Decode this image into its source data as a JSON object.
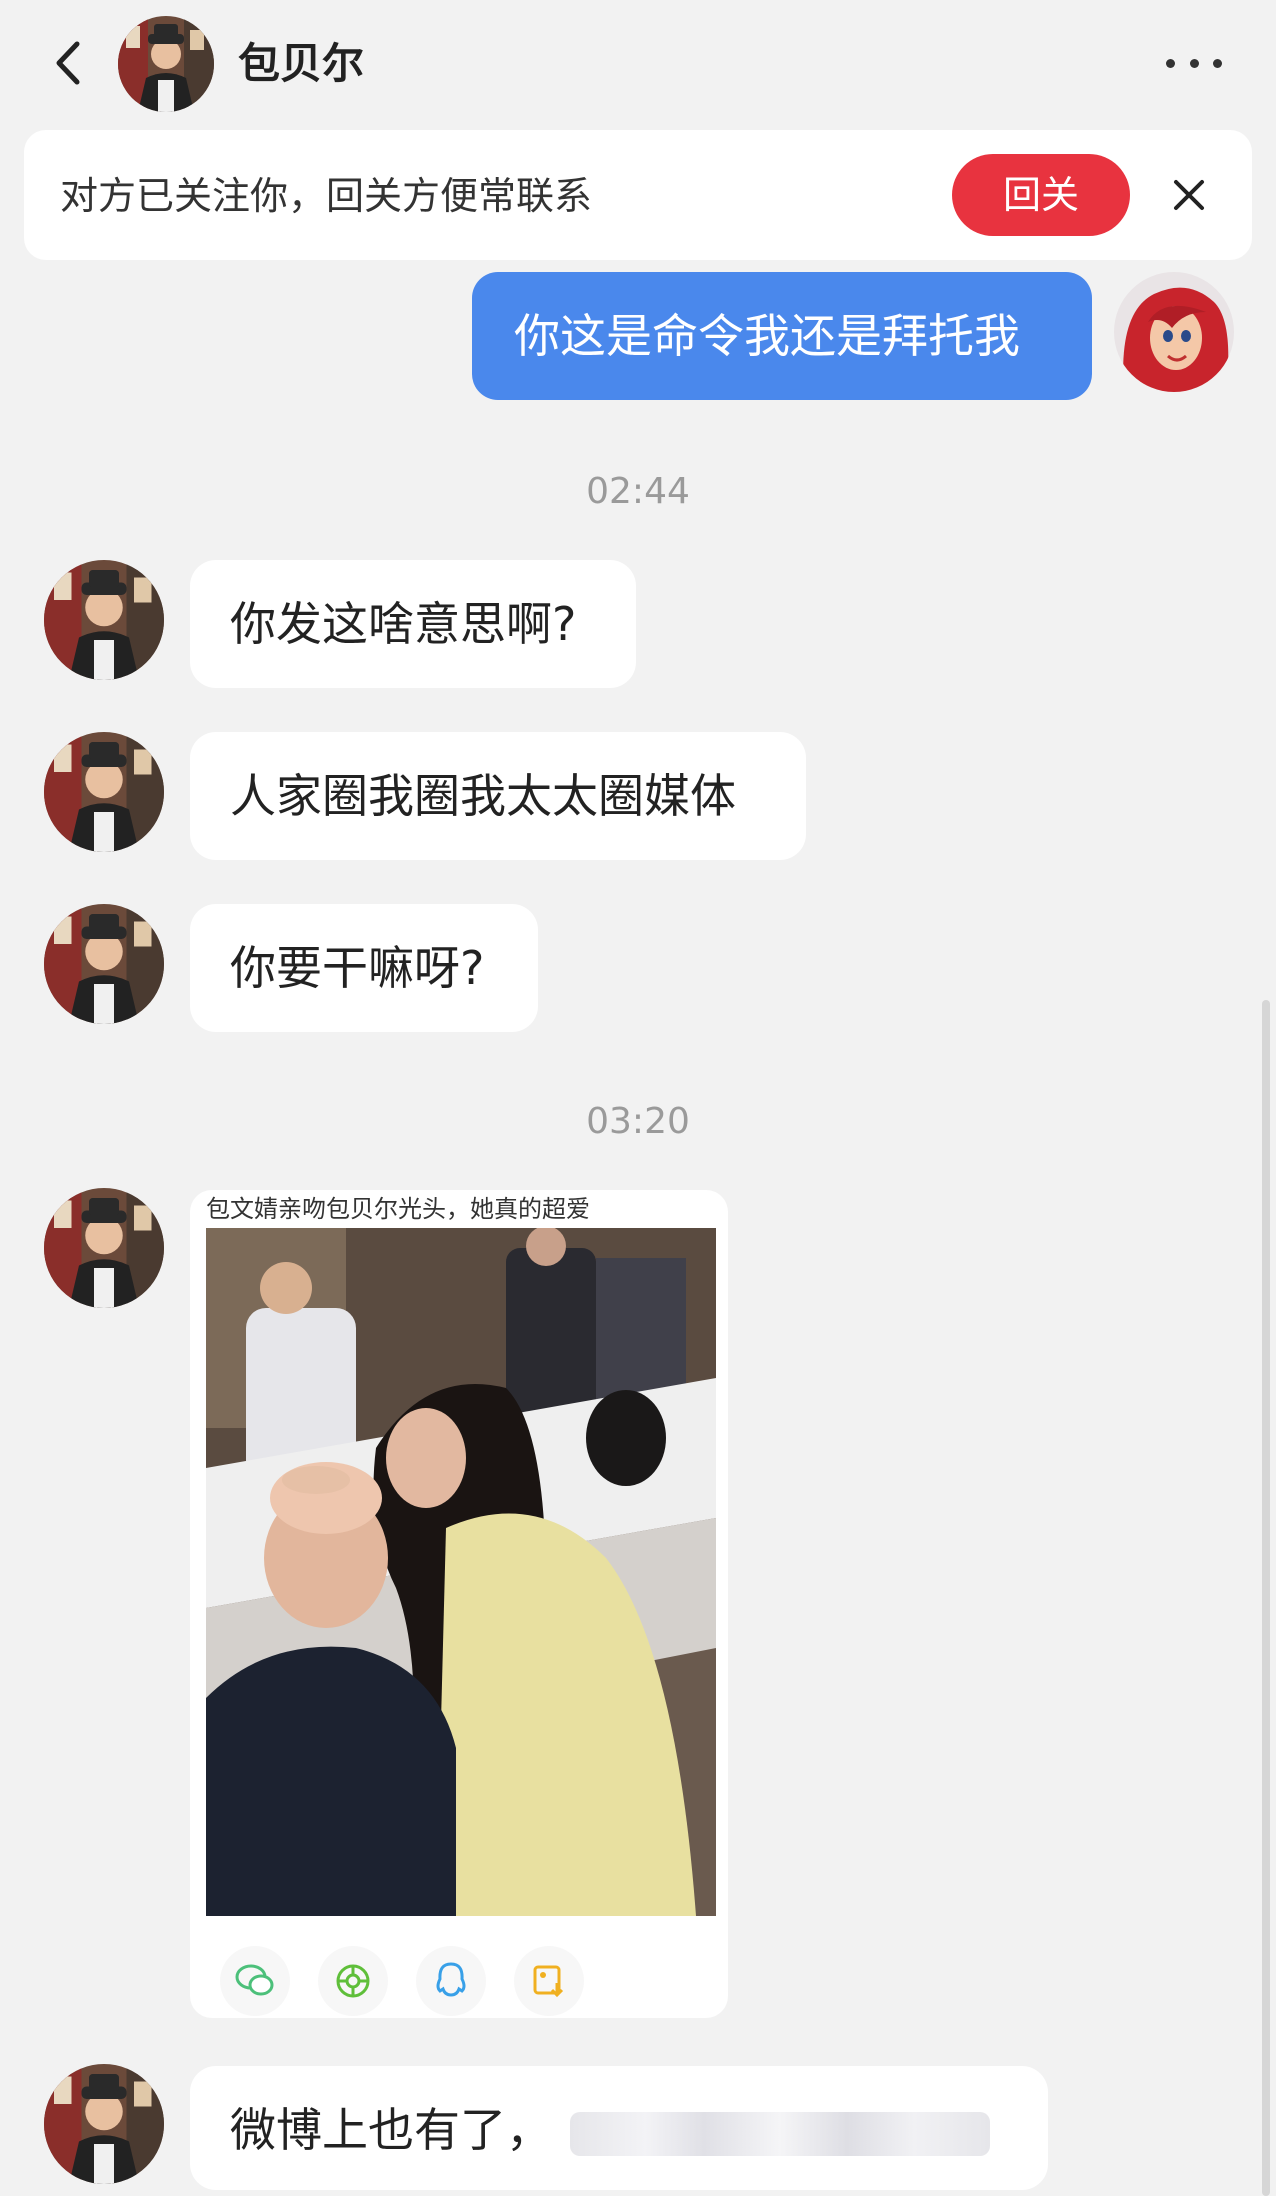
{
  "header": {
    "back_icon": "chevron-left-icon",
    "contact_name": "包贝尔",
    "more_icon": "more-horizontal-icon"
  },
  "follow_banner": {
    "text": "对方已关注你，回关方便常联系",
    "button_label": "回关",
    "close_icon": "close-icon"
  },
  "messages": [
    {
      "from": "me",
      "text": "你这是命令我还是拜托我"
    },
    {
      "type": "time",
      "text": "02:44"
    },
    {
      "from": "them",
      "text": "你发这啥意思啊?"
    },
    {
      "from": "them",
      "text": "人家圈我圈我太太圈媒体"
    },
    {
      "from": "them",
      "text": "你要干嘛呀?"
    },
    {
      "type": "time",
      "text": "03:20"
    },
    {
      "from": "them",
      "type": "share-card",
      "title": "包文婧亲吻包贝尔光头，她真的超爱"
    },
    {
      "from": "them",
      "text": "微博上也有了，"
    }
  ],
  "share_actions": [
    "wechat-icon",
    "moments-icon",
    "qq-icon",
    "save-image-icon"
  ],
  "colors": {
    "background": "#f2f2f2",
    "outgoing_bubble": "#4a88ec",
    "incoming_bubble": "#ffffff",
    "follow_button": "#e8333f",
    "timestamp": "#9a9a9a"
  }
}
